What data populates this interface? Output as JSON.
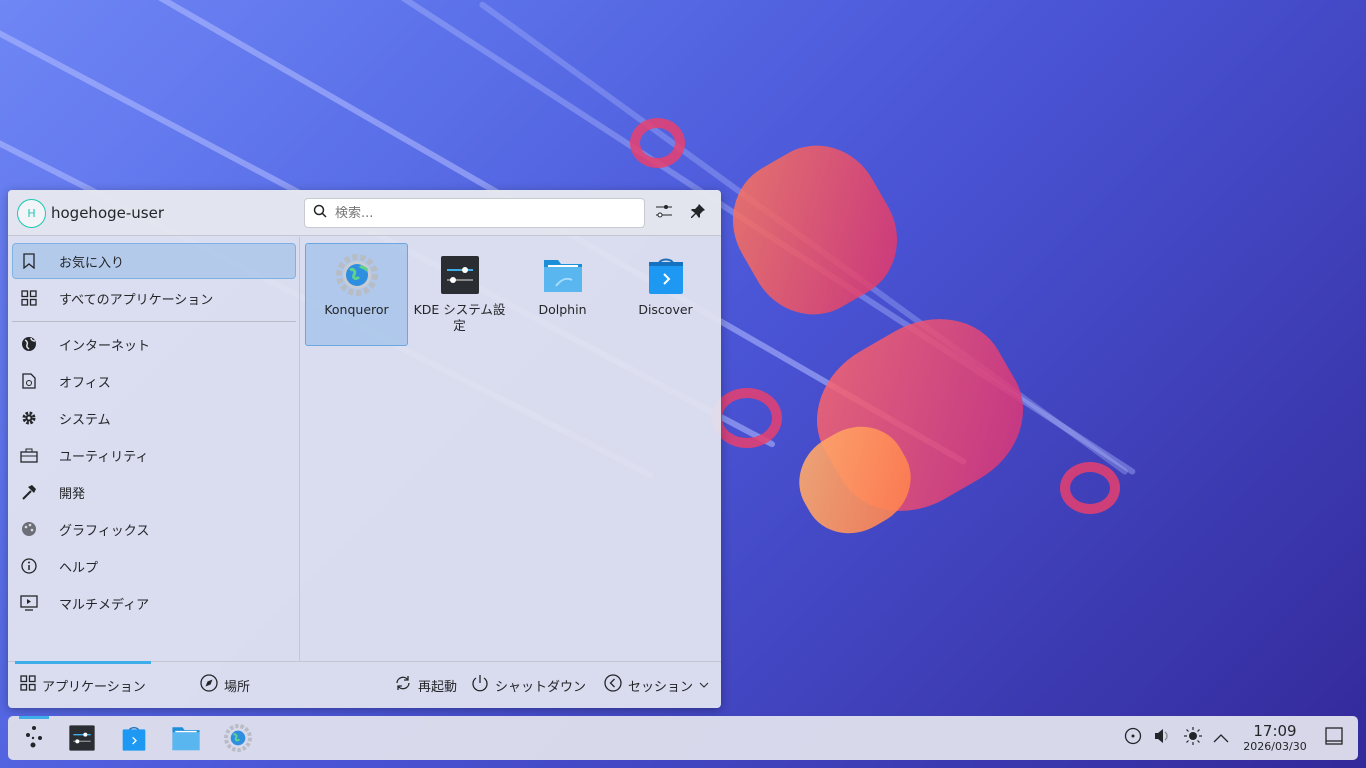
{
  "user": {
    "initial": "H",
    "name": "hogehoge-user"
  },
  "search": {
    "placeholder": "検索..."
  },
  "header": {
    "configure_icon": "sliders-icon",
    "pin_icon": "pin-icon"
  },
  "sidebar": {
    "items": [
      {
        "label": "お気に入り",
        "icon": "bookmark-icon"
      },
      {
        "label": "すべてのアプリケーション",
        "icon": "grid-icon"
      },
      {
        "label": "インターネット",
        "icon": "globe-icon"
      },
      {
        "label": "オフィス",
        "icon": "document-icon"
      },
      {
        "label": "システム",
        "icon": "gear-icon"
      },
      {
        "label": "ユーティリティ",
        "icon": "toolbox-icon"
      },
      {
        "label": "開発",
        "icon": "hammer-icon"
      },
      {
        "label": "グラフィックス",
        "icon": "palette-icon"
      },
      {
        "label": "ヘルプ",
        "icon": "info-icon"
      },
      {
        "label": "マルチメディア",
        "icon": "monitor-play-icon"
      }
    ]
  },
  "favorites": [
    {
      "label": "Konqueror"
    },
    {
      "label": "KDE システム設定"
    },
    {
      "label": "Dolphin"
    },
    {
      "label": "Discover"
    }
  ],
  "footer": {
    "applications": "アプリケーション",
    "places": "場所",
    "restart": "再起動",
    "shutdown": "シャットダウン",
    "session": "セッション"
  },
  "clock": {
    "time": "17:09",
    "date": "2026/03/30"
  },
  "colors": {
    "accent": "#3daee9",
    "selection": "#93bae8"
  }
}
